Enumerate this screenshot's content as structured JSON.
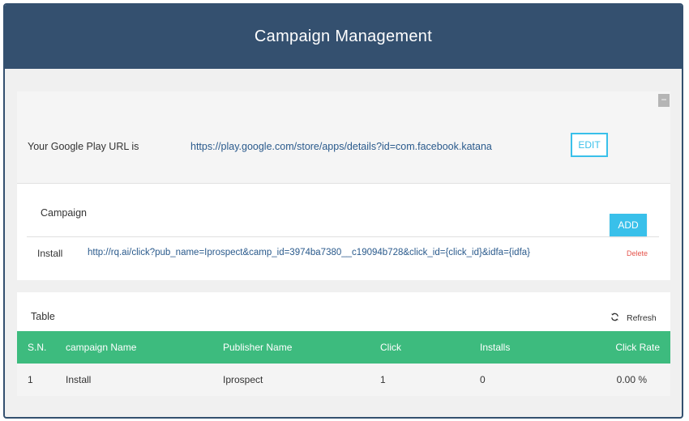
{
  "header": {
    "title": "Campaign Management"
  },
  "url_panel": {
    "label": "Your Google Play URL is",
    "url": "https://play.google.com/store/apps/details?id=com.facebook.katana",
    "edit_label": "EDIT",
    "collapse_label": "−"
  },
  "campaign_panel": {
    "title": "Campaign",
    "add_label": "ADD",
    "rows": [
      {
        "name": "Install",
        "url": "http://rq.ai/click?pub_name=Iprospect&camp_id=3974ba7380__c19094b728&click_id={click_id}&idfa={idfa}",
        "delete_label": "Delete"
      }
    ]
  },
  "table_panel": {
    "title": "Table",
    "refresh_label": "Refresh",
    "columns": [
      "S.N.",
      "campaign Name",
      "Publisher Name",
      "Click",
      "Installs",
      "Click Rate"
    ],
    "rows": [
      [
        "1",
        "Install",
        "Iprospect",
        "1",
        "0",
        "0.00 %"
      ]
    ]
  },
  "colors": {
    "header_bg": "#34506f",
    "accent_blue": "#39c0ea",
    "table_header_green": "#3dbb7e",
    "link_blue": "#2a5a8c",
    "delete_red": "#e5534b"
  },
  "icons": {
    "refresh": "refresh-icon",
    "collapse": "minus-icon"
  }
}
